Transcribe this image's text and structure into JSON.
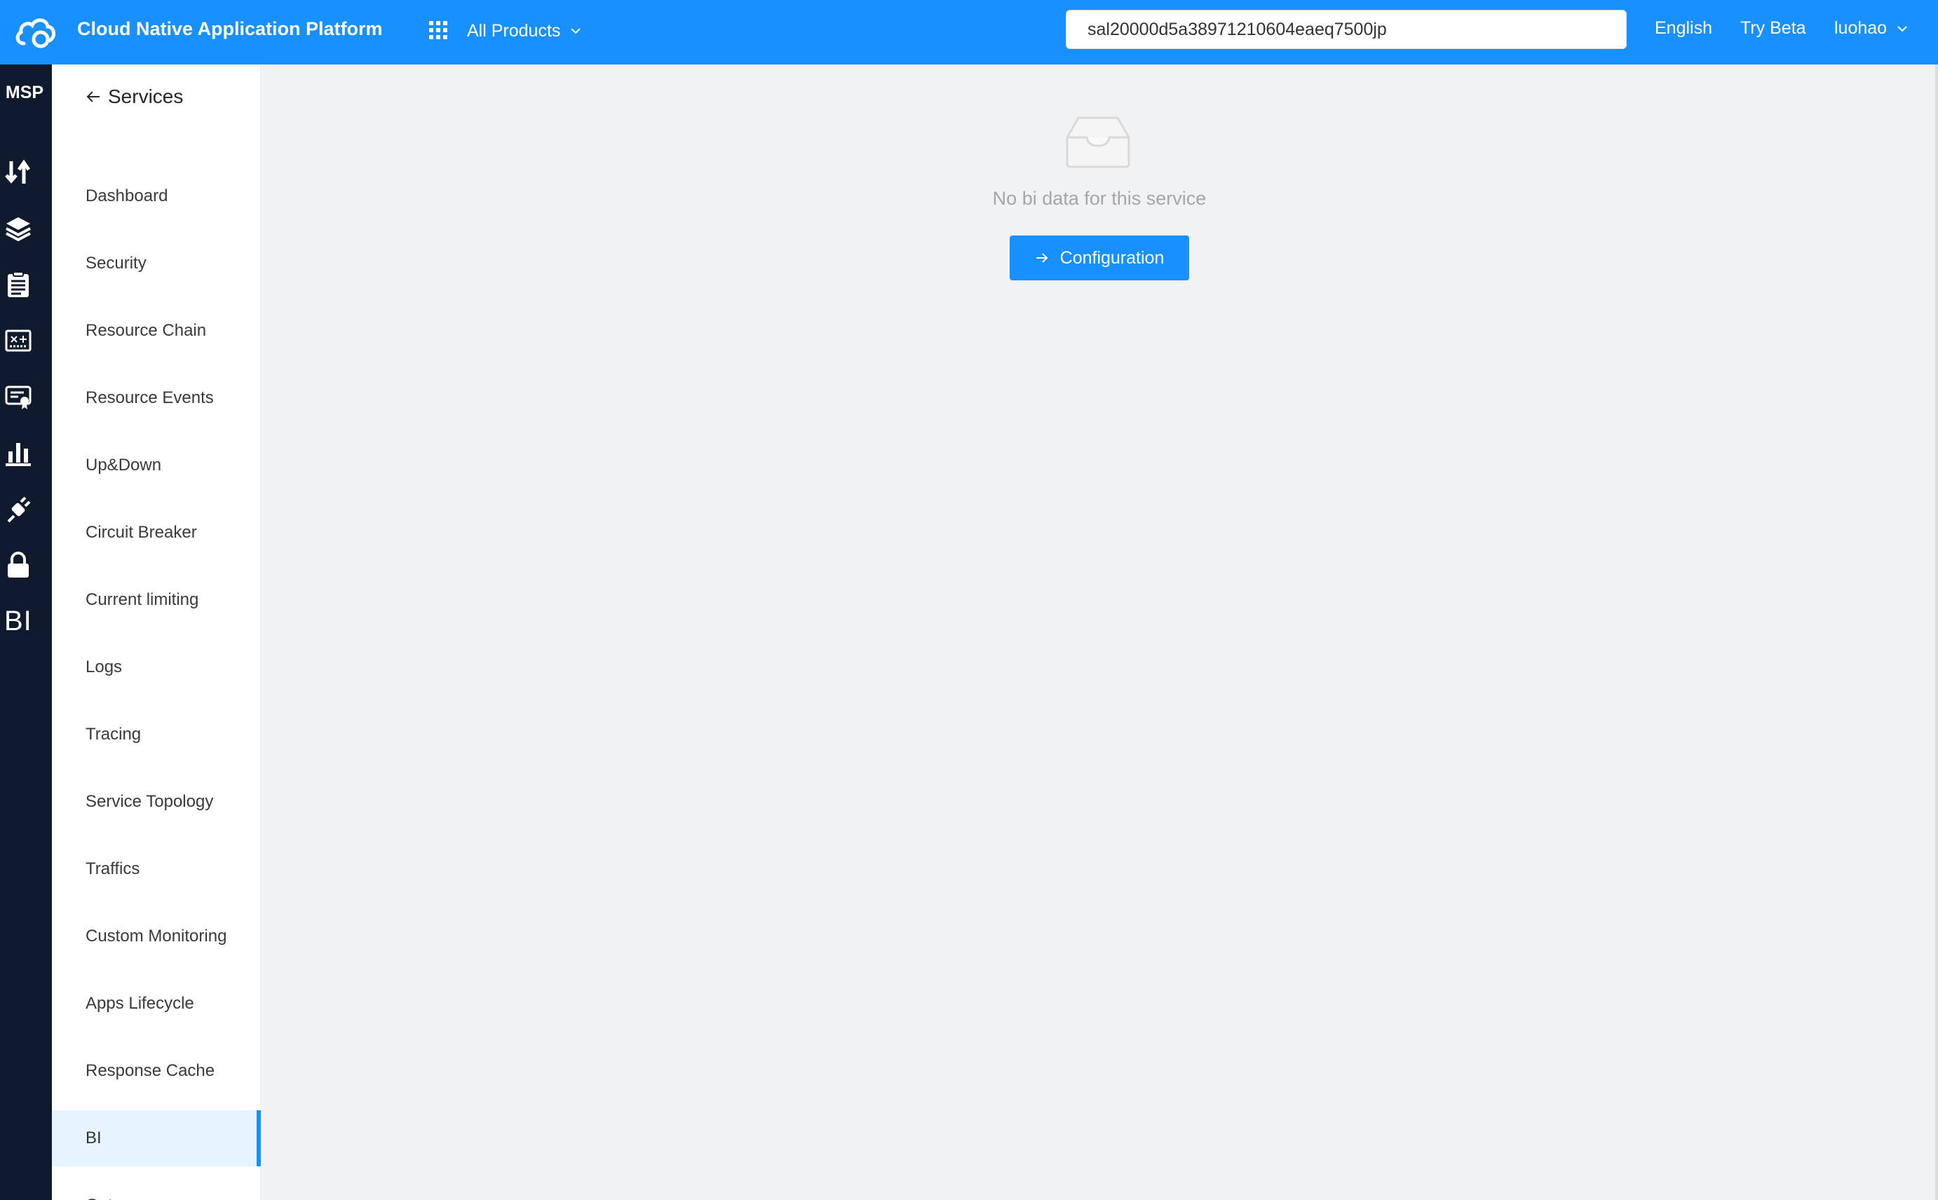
{
  "header": {
    "app_title": "Cloud Native Application Platform",
    "products_label": "All Products",
    "search_value": "sal20000d5a38971210604eaeq7500jp",
    "language_label": "English",
    "beta_label": "Try Beta",
    "user_label": "luohao"
  },
  "rail": {
    "brand": "MSP",
    "icons": [
      "transfer-icon",
      "layers-icon",
      "clipboard-icon",
      "router-icon",
      "certificate-icon",
      "bar-chart-icon",
      "plug-icon",
      "lock-icon",
      "bi-icon"
    ],
    "bi_label": "BI"
  },
  "submenu": {
    "back_label": "Services",
    "items": [
      {
        "label": "Dashboard"
      },
      {
        "label": "Security"
      },
      {
        "label": "Resource Chain"
      },
      {
        "label": "Resource Events"
      },
      {
        "label": "Up&Down"
      },
      {
        "label": "Circuit Breaker"
      },
      {
        "label": "Current limiting"
      },
      {
        "label": "Logs"
      },
      {
        "label": "Tracing"
      },
      {
        "label": "Service Topology"
      },
      {
        "label": "Traffics"
      },
      {
        "label": "Custom Monitoring"
      },
      {
        "label": "Apps Lifecycle"
      },
      {
        "label": "Response Cache"
      },
      {
        "label": "BI",
        "active": true
      },
      {
        "label": "Gateway"
      }
    ]
  },
  "main": {
    "empty_text": "No bi data for this service",
    "config_button": "Configuration"
  },
  "colors": {
    "primary": "#1890ff",
    "rail_bg": "#0f1a2e",
    "page_bg": "#f0f2f5",
    "active_item_bg": "#e6f4ff"
  }
}
